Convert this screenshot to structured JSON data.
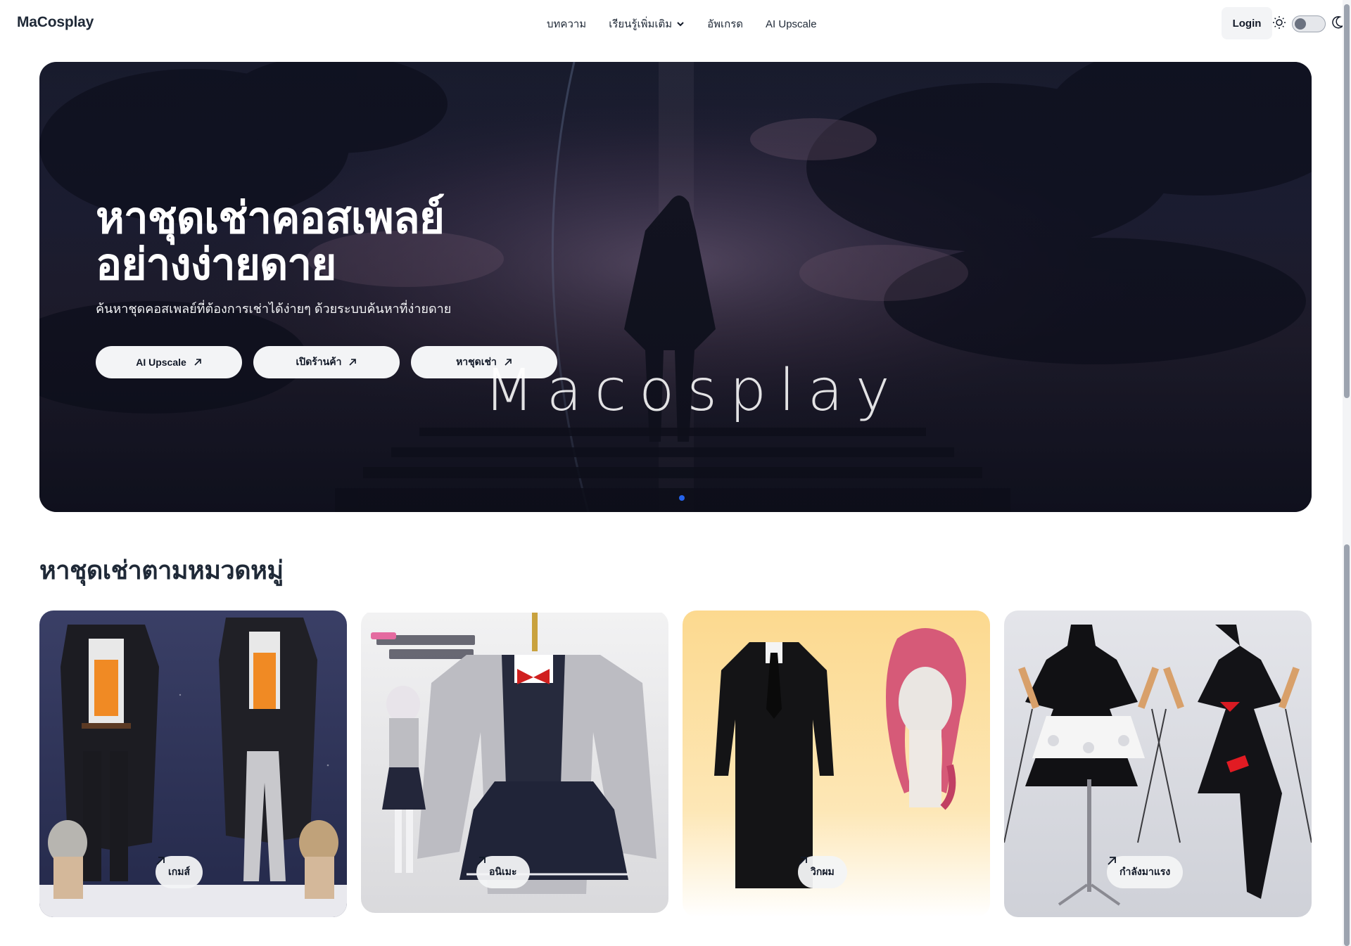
{
  "header": {
    "brand": "MaCosplay",
    "nav": [
      {
        "label": "บทความ"
      },
      {
        "label": "เรียนรู้เพิ่มเติม",
        "has_dropdown": true
      },
      {
        "label": "อัพเกรด"
      },
      {
        "label": "AI Upscale"
      }
    ],
    "login_label": "Login",
    "theme_toggle": {
      "light_icon": "sun-icon",
      "dark_icon": "moon-icon",
      "state": "light"
    }
  },
  "hero": {
    "title": "หาชุดเช่าคอสเพลย์\nอย่างง่ายดาย",
    "subtitle": "ค้นหาชุดคอสเพลย์ที่ต้องการเช่าได้ง่ายๆ ด้วยระบบค้นหาที่ง่ายดาย",
    "buttons": [
      {
        "label": "AI Upscale",
        "icon": "arrow-up-right-icon"
      },
      {
        "label": "เปิดร้านค้า",
        "icon": "arrow-up-right-icon"
      },
      {
        "label": "หาชุดเช่า",
        "icon": "arrow-up-right-icon"
      }
    ],
    "watermark": "Macosplay",
    "carousel": {
      "active_index": 0,
      "count": 1
    },
    "accent": "#2563eb"
  },
  "categories": {
    "title": "หาชุดเช่าตามหมวดหมู่",
    "items": [
      {
        "label": "เกมส์",
        "icon": "arrow-up-right-icon"
      },
      {
        "label": "อนิเมะ",
        "icon": "arrow-up-right-icon"
      },
      {
        "label": "วิกผม",
        "icon": "arrow-up-right-icon"
      },
      {
        "label": "กำลังมาแรง",
        "icon": "arrow-up-right-icon"
      }
    ]
  }
}
